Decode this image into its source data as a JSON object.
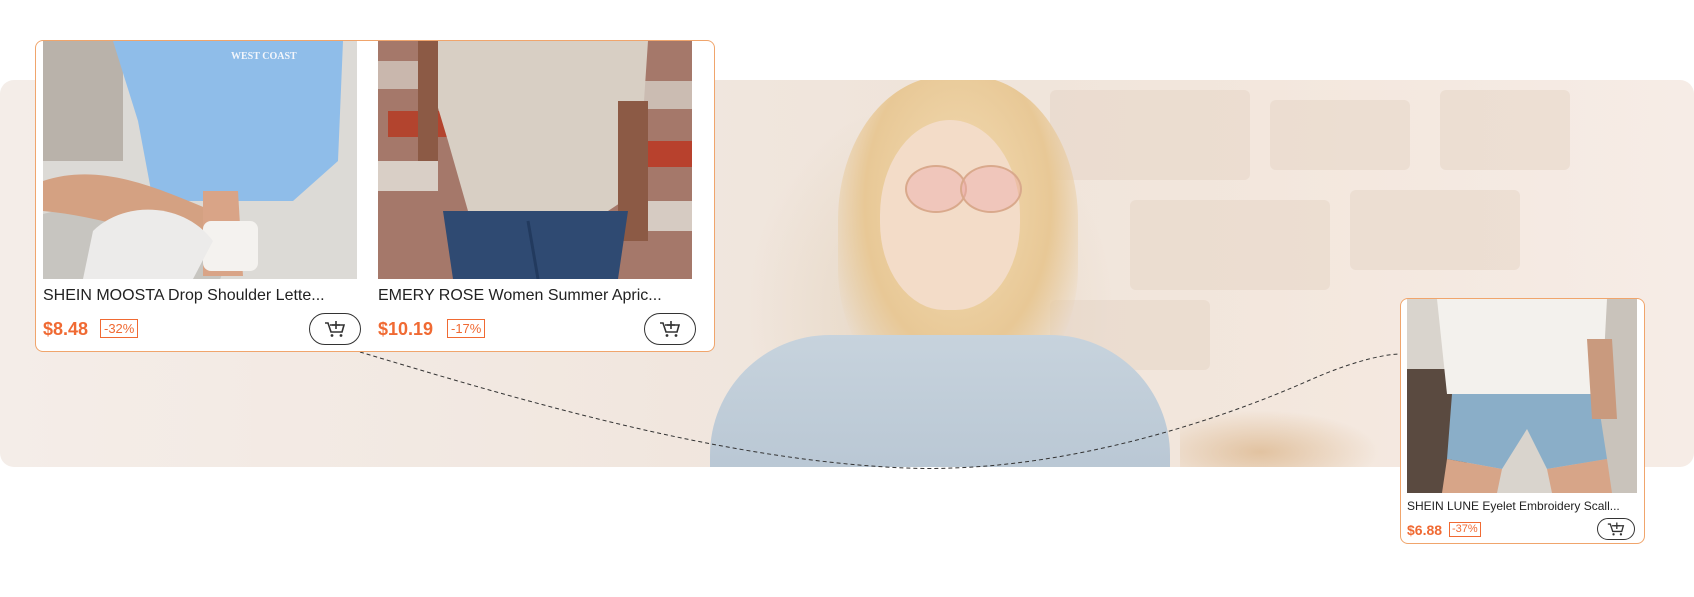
{
  "colors": {
    "accent": "#f06a33",
    "card_border": "#f0a56c",
    "banner_bg": "#f2e8e1"
  },
  "banner": {
    "description_icon": "lifestyle-banner"
  },
  "products": [
    {
      "title": "SHEIN MOOSTA Drop Shoulder Lette...",
      "price": "$8.48",
      "discount": "-32%",
      "cart_icon": "add-to-cart-icon",
      "photo_print": "WEST COAST"
    },
    {
      "title": "EMERY ROSE Women Summer Apric...",
      "price": "$10.19",
      "discount": "-17%",
      "cart_icon": "add-to-cart-icon"
    },
    {
      "title": "SHEIN LUNE Eyelet Embroidery Scall...",
      "price": "$6.88",
      "discount": "-37%",
      "cart_icon": "add-to-cart-icon"
    }
  ]
}
